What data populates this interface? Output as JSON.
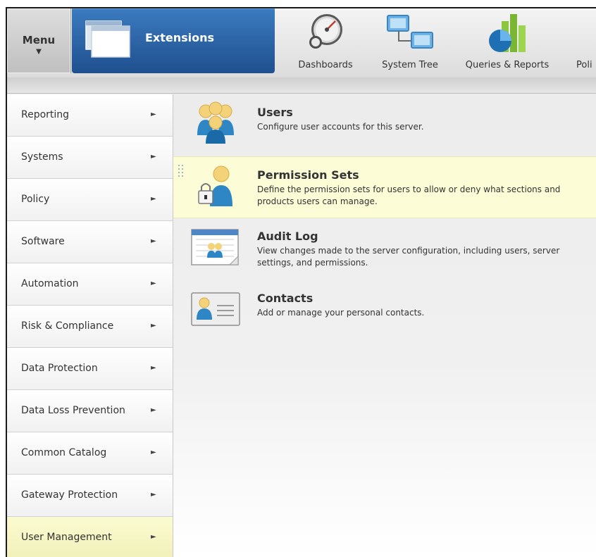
{
  "topbar": {
    "menu_label": "Menu",
    "menu_arrow": "▼",
    "current_label": "Extensions",
    "nav_items": [
      {
        "label": "Dashboards",
        "icon": "dashboard-gauge-icon"
      },
      {
        "label": "System Tree",
        "icon": "system-tree-icon"
      },
      {
        "label": "Queries & Reports",
        "icon": "queries-reports-icon"
      },
      {
        "label": "Poli",
        "icon": ""
      }
    ]
  },
  "sidebar": {
    "arrow": "►",
    "items": [
      {
        "label": "Reporting"
      },
      {
        "label": "Systems"
      },
      {
        "label": "Policy"
      },
      {
        "label": "Software"
      },
      {
        "label": "Automation"
      },
      {
        "label": "Risk & Compliance"
      },
      {
        "label": "Data Protection"
      },
      {
        "label": "Data Loss Prevention"
      },
      {
        "label": "Common Catalog"
      },
      {
        "label": "Gateway Protection"
      },
      {
        "label": "User Management",
        "active": true
      }
    ]
  },
  "main": {
    "items": [
      {
        "title": "Users",
        "description": "Configure user accounts for this server.",
        "icon": "users-group-icon"
      },
      {
        "title": "Permission Sets",
        "description": "Define the permission sets for users to allow or deny what sections and products users can manage.",
        "icon": "permission-lock-user-icon",
        "highlighted": true
      },
      {
        "title": "Audit Log",
        "description": "View changes made to the server configuration, including users, server settings, and permissions.",
        "icon": "audit-log-icon"
      },
      {
        "title": "Contacts",
        "description": "Add or manage your personal contacts.",
        "icon": "contact-card-icon"
      }
    ]
  },
  "colors": {
    "extensions_blue": "#2a5fa3",
    "highlight_yellow": "#fcfcd6",
    "active_sidebar": "#f5f5c4"
  }
}
